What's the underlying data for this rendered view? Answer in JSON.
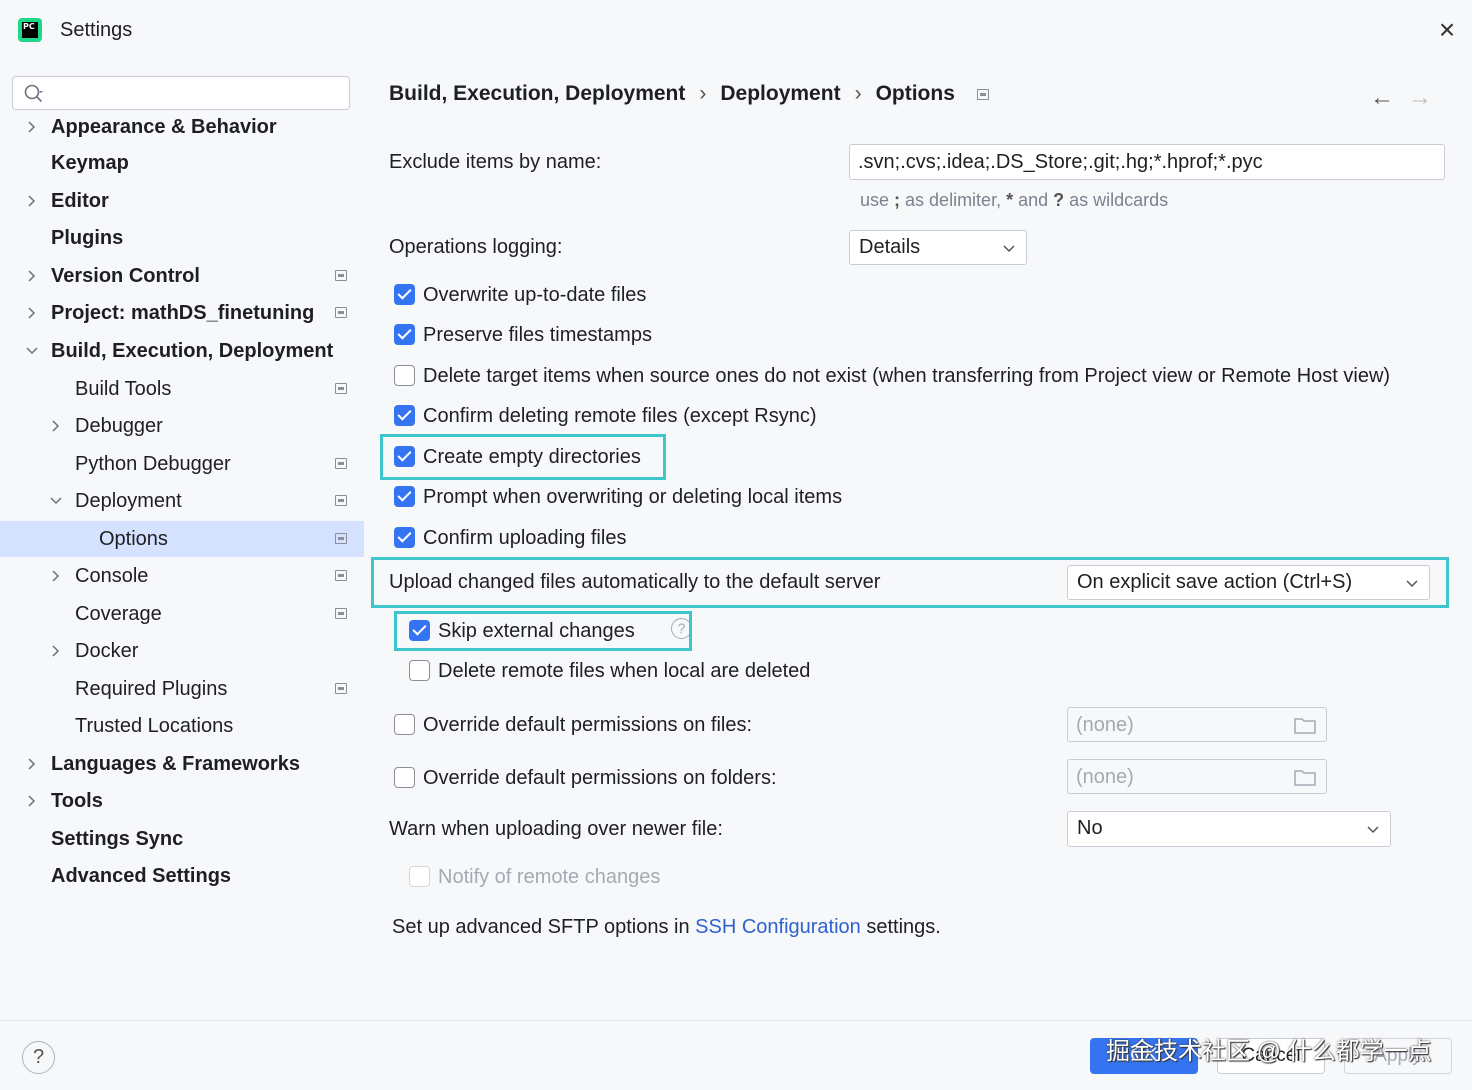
{
  "window": {
    "title": "Settings",
    "app_logo_text": "PC"
  },
  "search": {
    "placeholder": "",
    "value": ""
  },
  "sidebar": {
    "items": [
      {
        "label": "Appearance & Behavior",
        "expandable": true,
        "expanded": false
      },
      {
        "label": "Keymap"
      },
      {
        "label": "Editor",
        "expandable": true,
        "expanded": false
      },
      {
        "label": "Plugins"
      },
      {
        "label": "Version Control",
        "expandable": true,
        "expanded": false,
        "project_icon": true
      },
      {
        "label": "Project: mathDS_finetuning",
        "expandable": true,
        "expanded": false,
        "project_icon": true
      },
      {
        "label": "Build, Execution, Deployment",
        "expandable": true,
        "expanded": true
      },
      {
        "label": "Build Tools",
        "project_icon": true
      },
      {
        "label": "Debugger",
        "expandable": true,
        "expanded": false
      },
      {
        "label": "Python Debugger",
        "project_icon": true
      },
      {
        "label": "Deployment",
        "expandable": true,
        "expanded": true,
        "project_icon": true
      },
      {
        "label": "Options",
        "selected": true,
        "project_icon": true
      },
      {
        "label": "Console",
        "expandable": true,
        "expanded": false,
        "project_icon": true
      },
      {
        "label": "Coverage",
        "project_icon": true
      },
      {
        "label": "Docker",
        "expandable": true,
        "expanded": false
      },
      {
        "label": "Required Plugins",
        "project_icon": true
      },
      {
        "label": "Trusted Locations"
      },
      {
        "label": "Languages & Frameworks",
        "expandable": true,
        "expanded": false
      },
      {
        "label": "Tools",
        "expandable": true,
        "expanded": false
      },
      {
        "label": "Settings Sync"
      },
      {
        "label": "Advanced Settings"
      }
    ]
  },
  "breadcrumb": {
    "parts": [
      "Build, Execution, Deployment",
      "Deployment",
      "Options"
    ],
    "separator": "›",
    "back_icon": "←",
    "forward_icon": "→"
  },
  "form": {
    "exclude": {
      "label": "Exclude items by name:",
      "value": ".svn;.cvs;.idea;.DS_Store;.git;.hg;*.hprof;*.pyc",
      "hint_parts": [
        "use ",
        ";",
        " as delimiter, ",
        "*",
        " and ",
        "?",
        " as wildcards"
      ]
    },
    "operations_logging": {
      "label": "Operations logging:",
      "value": "Details"
    },
    "checkboxes": [
      {
        "label": "Overwrite up-to-date files",
        "checked": true
      },
      {
        "label": "Preserve files timestamps",
        "checked": true
      },
      {
        "label": "Delete target items when source ones do not exist (when transferring from Project view or Remote Host view)",
        "checked": false
      },
      {
        "label": "Confirm deleting remote files (except Rsync)",
        "checked": true
      },
      {
        "label": "Create empty directories",
        "checked": true
      },
      {
        "label": "Prompt when overwriting or deleting local items",
        "checked": true
      },
      {
        "label": "Confirm uploading files",
        "checked": true
      }
    ],
    "upload_auto": {
      "label": "Upload changed files automatically to the default server",
      "value": "On explicit save action (Ctrl+S)"
    },
    "skip_external": {
      "label": "Skip external changes",
      "checked": true,
      "help_icon": "?"
    },
    "delete_remote": {
      "label": "Delete remote files when local are deleted",
      "checked": false
    },
    "override_files": {
      "label": "Override default permissions on files:",
      "checked": false,
      "value": "(none)"
    },
    "override_folders": {
      "label": "Override default permissions on folders:",
      "checked": false,
      "value": "(none)"
    },
    "warn_newer": {
      "label": "Warn when uploading over newer file:",
      "value": "No"
    },
    "notify_remote": {
      "label": "Notify of remote changes",
      "checked": false,
      "disabled": true
    },
    "sftp": {
      "prefix": "Set up advanced SFTP options in ",
      "link": "SSH Configuration",
      "suffix": " settings."
    }
  },
  "footer": {
    "help": "?",
    "ok": "OK",
    "cancel": "Cancel",
    "apply": "Apply",
    "watermark": "掘金技术社区 @ 什么都学一点"
  },
  "colors": {
    "accent": "#3574f0",
    "highlight": "#3fc5cc",
    "selected_row": "#d4e2ff",
    "link": "#2e62d0"
  }
}
